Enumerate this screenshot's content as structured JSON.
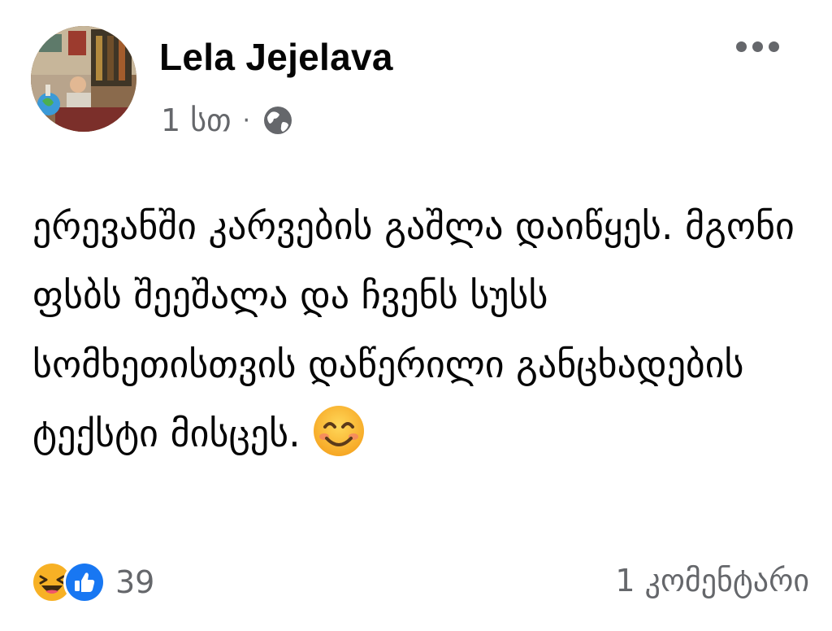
{
  "post": {
    "author": "Lela Jejelava",
    "timestamp": "1 სთ",
    "separator": "·",
    "audience_icon": "globe-icon",
    "more_icon": "more-options-icon",
    "text": "ერევანში კარვების გაშლა დაიწყეს. მგონი ფსბს შეეშალა და ჩვენს სუსს სომხეთისთვის დაწერილი განცხადების ტექსტი მისცეს.",
    "inline_emoji": "smiling-face-with-smiling-eyes",
    "reactions": {
      "types": [
        "haha",
        "like"
      ],
      "count": "39"
    },
    "comments_label": "1 კომენტარი"
  },
  "colors": {
    "primary_text": "#050505",
    "secondary_text": "#65676b",
    "like_blue": "#1877f2",
    "haha_yellow": "#f7b125"
  }
}
